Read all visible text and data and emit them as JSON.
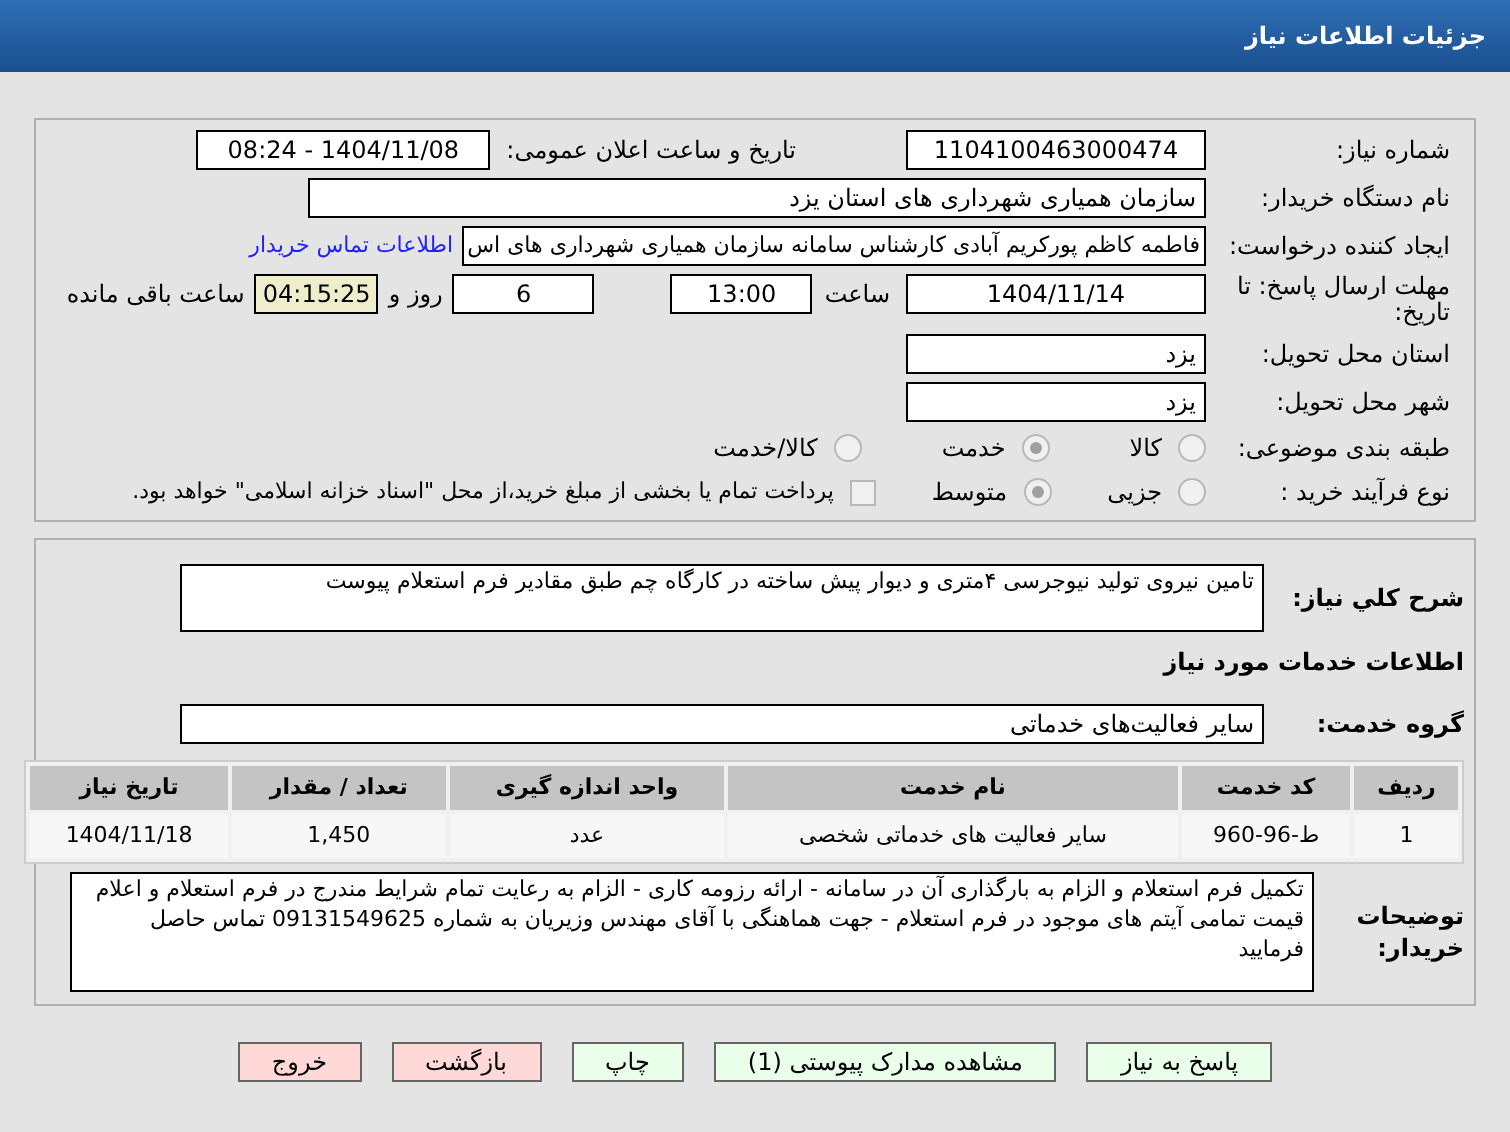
{
  "header": {
    "title": "جزئیات اطلاعات نیاز"
  },
  "need_number": {
    "label": "شماره نیاز:",
    "value": "1104100463000474"
  },
  "announce": {
    "label": "تاریخ و ساعت اعلان عمومی:",
    "value": "1404/11/08 - 08:24"
  },
  "buyer": {
    "label": "نام دستگاه خریدار:",
    "value": "سازمان همیاری شهرداری های استان یزد"
  },
  "creator": {
    "label": "ایجاد کننده درخواست:",
    "value": "فاطمه کاظم پورکریم آبادی کارشناس سامانه سازمان همیاری شهرداری های اس",
    "link": "اطلاعات تماس خریدار"
  },
  "deadline": {
    "label": "مهلت ارسال پاسخ: تا تاریخ:",
    "date": "1404/11/14",
    "time_label": "ساعت",
    "time": "13:00",
    "days": "6",
    "days_label": "روز و",
    "remaining": "04:15:25",
    "remaining_label": "ساعت باقی مانده"
  },
  "province": {
    "label": "استان محل تحویل:",
    "value": "یزد"
  },
  "city": {
    "label": "شهر محل تحویل:",
    "value": "یزد"
  },
  "category": {
    "label": "طبقه بندی موضوعی:",
    "options": [
      {
        "label": "کالا",
        "selected": false
      },
      {
        "label": "خدمت",
        "selected": true
      },
      {
        "label": "کالا/خدمت",
        "selected": false
      }
    ]
  },
  "process": {
    "label": "نوع فرآیند خرید :",
    "options": [
      {
        "label": "جزیی",
        "selected": false
      },
      {
        "label": "متوسط",
        "selected": true
      }
    ],
    "treasury": {
      "checked": false,
      "text": "پرداخت تمام یا بخشی از مبلغ خرید،از محل \"اسناد خزانه اسلامی\" خواهد بود."
    }
  },
  "description": {
    "label": "شرح کلي نیاز:",
    "value": "تامین نیروی تولید نیوجرسی ۴متری و دیوار پیش ساخته در کارگاه چم طبق مقادیر فرم استعلام پیوست"
  },
  "services_title": "اطلاعات خدمات مورد نیاز",
  "service_group": {
    "label": "گروه خدمت:",
    "value": "سایر فعالیت‌های خدماتی"
  },
  "table": {
    "columns": [
      "ردیف",
      "کد خدمت",
      "نام خدمت",
      "واحد اندازه گیری",
      "تعداد / مقدار",
      "تاریخ نیاز"
    ],
    "rows": [
      [
        "1",
        "ط-96-960",
        "سایر فعالیت های خدماتی شخصی",
        "عدد",
        "1,450",
        "1404/11/18"
      ]
    ]
  },
  "buyer_notes": {
    "label": "توضیحات خریدار:",
    "value": "تکمیل فرم استعلام و الزام به بارگذاری آن در سامانه - ارائه رزومه کاری - الزام به رعایت تمام شرایط مندرج در فرم استعلام و اعلام قیمت تمامی آیتم های موجود در فرم استعلام - جهت هماهنگی با آقای مهندس وزیریان به شماره 09131549625 تماس حاصل فرمایید"
  },
  "buttons": [
    {
      "label": "پاسخ به نیاز",
      "kind": "green"
    },
    {
      "label": "مشاهده مدارک پیوستی (1)",
      "kind": "green"
    },
    {
      "label": "چاپ",
      "kind": "green"
    },
    {
      "label": "بازگشت",
      "kind": "red"
    },
    {
      "label": "خروج",
      "kind": "red"
    }
  ]
}
